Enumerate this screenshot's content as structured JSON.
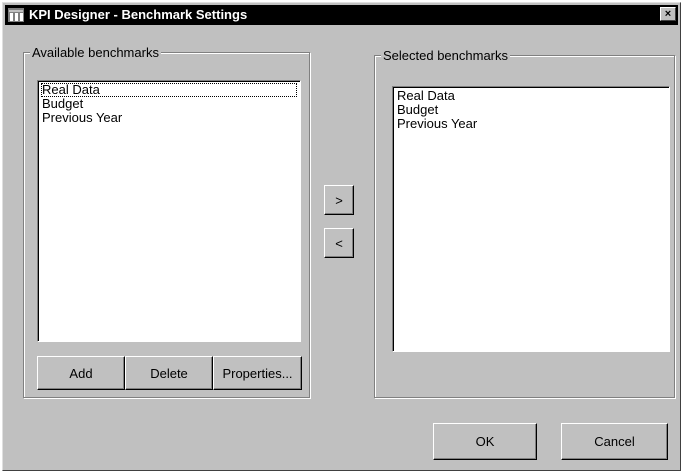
{
  "window": {
    "title": "KPI Designer - Benchmark Settings",
    "close_label": "×"
  },
  "available": {
    "label": "Available benchmarks",
    "items": [
      "Real Data",
      "Budget",
      "Previous Year"
    ],
    "focused_index": 0,
    "buttons": {
      "add": "Add",
      "delete": "Delete",
      "properties": "Properties..."
    }
  },
  "transfer": {
    "add_label": ">",
    "remove_label": "<"
  },
  "selected": {
    "label": "Selected benchmarks",
    "items": [
      "Real Data",
      "Budget",
      "Previous Year"
    ]
  },
  "footer": {
    "ok": "OK",
    "cancel": "Cancel"
  }
}
